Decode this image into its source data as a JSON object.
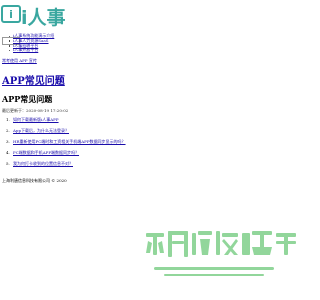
{
  "logo": {
    "mark": "i",
    "text": "i人事"
  },
  "search": {
    "value": "",
    "placeholder": ""
  },
  "nav": {
    "items": [
      "i人事系统功能演示介绍",
      "i人事人力资源SaaS",
      "i人事招聘平台",
      "i人事开放平台"
    ]
  },
  "breadcrumb": {
    "text": "常考使用 APP 宣传"
  },
  "page": {
    "title": "APP常见问题",
    "subtitle": "APP常见问题",
    "updated": "最后更新于：2020-08-19 17:20:02"
  },
  "faq": [
    {
      "num": "1.",
      "label": "如何下载最新版i人事APP"
    },
    {
      "num": "2.",
      "label": "App下载后，为什么无法登录？"
    },
    {
      "num": "3.",
      "label": "HR重新使用PC端时和工资相关手机端APP数据同步显示的吗？"
    },
    {
      "num": "4.",
      "label": "PC端数据和手机APP端数据同步吗？"
    },
    {
      "num": "5.",
      "label": "我为何打卡收到的位置信息不对？"
    }
  ],
  "footer": {
    "text": "上海利唐信息科技有限公司 © 2020"
  },
  "colors": {
    "brand": "#3aa7a0",
    "link": "#1a0dab",
    "watermark": "#7fd08a"
  }
}
